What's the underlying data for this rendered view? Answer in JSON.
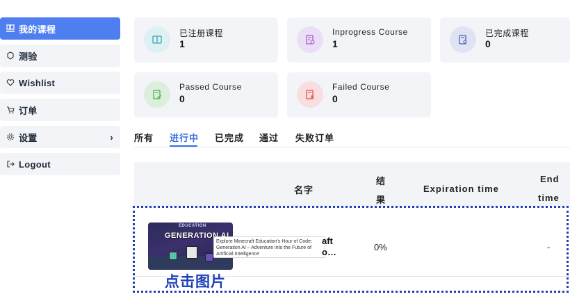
{
  "sidebar": {
    "items": [
      {
        "label": "我的课程",
        "icon": "course-icon",
        "active": true
      },
      {
        "label": "测验",
        "icon": "quiz-icon"
      },
      {
        "label": "Wishlist",
        "icon": "heart-icon"
      },
      {
        "label": "订单",
        "icon": "cart-icon"
      },
      {
        "label": "设置",
        "icon": "gear-icon",
        "chevron": "›"
      },
      {
        "label": "Logout",
        "icon": "logout-icon"
      }
    ]
  },
  "stats": [
    {
      "label": "已注册课程",
      "value": "1",
      "icon": "book-icon",
      "color": "#3aa8b8",
      "bg": "#dff0f3"
    },
    {
      "label": "Inprogress Course",
      "value": "1",
      "icon": "clock-doc-icon",
      "color": "#9b59d0",
      "bg": "#ebdff6"
    },
    {
      "label": "已完成课程",
      "value": "0",
      "icon": "certificate-icon",
      "color": "#4a5db0",
      "bg": "#e0e3f3"
    },
    {
      "label": "Passed Course",
      "value": "0",
      "icon": "check-doc-icon",
      "color": "#4caf50",
      "bg": "#dcefdc"
    },
    {
      "label": "Failed Course",
      "value": "0",
      "icon": "x-doc-icon",
      "color": "#e0504a",
      "bg": "#f8dede"
    }
  ],
  "tabs": [
    "所有",
    "进行中",
    "已完成",
    "通过",
    "失败订单"
  ],
  "table": {
    "headers": {
      "name": "名字",
      "result_line1": "结",
      "result_line2": "果",
      "expiration": "Expiration time",
      "end_line1": "End",
      "end_line2": "time"
    },
    "row": {
      "thumb_title": "GENERATION AI",
      "thumb_brand": "EDUCATION",
      "tooltip": "Explore Minecraft Education's Hour of Code: Generation AI – Adventure into the Future of Artificial Intelligence",
      "name_line1": "aft",
      "name_line2": "o…",
      "result": "0%",
      "end": "-"
    }
  },
  "annotation": "点击图片"
}
